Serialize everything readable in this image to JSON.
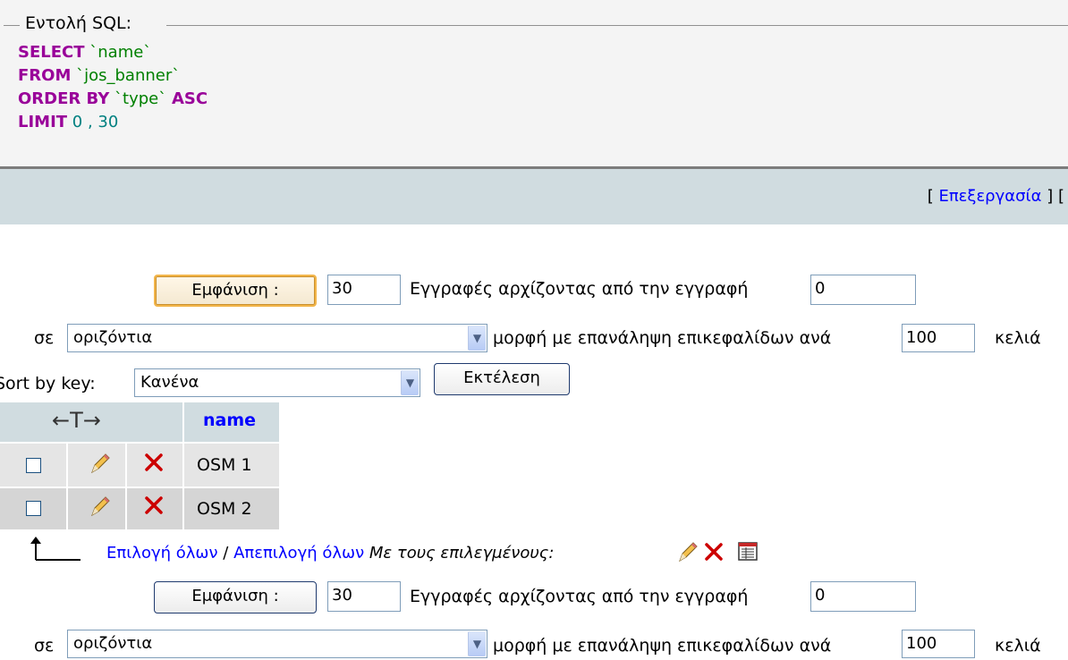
{
  "sql": {
    "legend": "Εντολή SQL:",
    "line1": {
      "kw": "SELECT",
      "rest": "`name`"
    },
    "line2": {
      "kw": "FROM",
      "rest": "`jos_banner`"
    },
    "line3": {
      "kw": "ORDER BY",
      "mid": "`type`",
      "kw2": "ASC"
    },
    "line4": {
      "kw": "LIMIT",
      "rest": "0 , 30"
    }
  },
  "toolbar": {
    "bracket_open": "[",
    "edit_link": "Επεξεργασία",
    "bracket_close": "] ["
  },
  "nav_top": {
    "show_button": "Εμφάνιση :",
    "rows_value": "30",
    "records_label": "Εγγραφές αρχίζοντας από την εγγραφή",
    "start_value": "0",
    "in_label": "σε",
    "mode_value": "οριζόντια",
    "repeat_label": "μορφή με επανάληψη επικεφαλίδων ανά",
    "repeat_value": "100",
    "cells_label": "κελιά"
  },
  "sort": {
    "label": "Sort by key:",
    "value": "Κανένα",
    "go_button": "Εκτέλεση"
  },
  "table": {
    "arrows_header": "←T→",
    "name_header": "name",
    "rows": [
      {
        "name": "OSM 1"
      },
      {
        "name": "OSM 2"
      }
    ]
  },
  "bulk": {
    "select_all": "Επιλογή όλων",
    "separator": "/",
    "unselect_all": "Απεπιλογή όλων",
    "with_selected": "Με τους επιλεγμένους:"
  },
  "nav_bottom": {
    "show_button": "Εμφάνιση :",
    "rows_value": "30",
    "records_label": "Εγγραφές αρχίζοντας από την εγγραφή",
    "start_value": "0",
    "in_label": "σε",
    "mode_value": "οριζόντια",
    "repeat_label": "μορφή με επανάληψη επικεφαλίδων ανά",
    "repeat_value": "100",
    "cells_label": "κελιά"
  },
  "icons": {
    "edit": "pencil-icon",
    "delete": "delete-x-icon",
    "export": "export-icon",
    "arrow": "arrow-up-left-icon",
    "delete_color": "#cc0000",
    "link_color": "#0000ff",
    "keyword_color": "#990099"
  }
}
